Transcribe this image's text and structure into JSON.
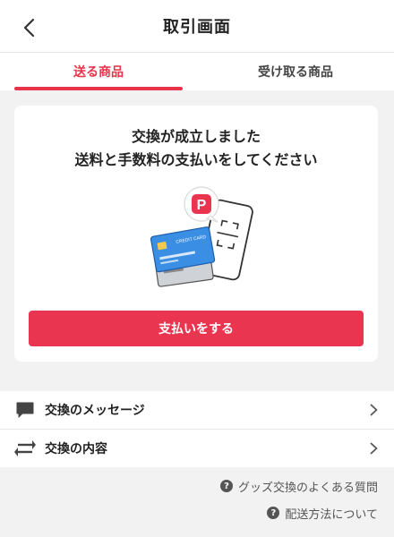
{
  "header": {
    "title": "取引画面",
    "back_icon": "chevron-left-icon"
  },
  "tabs": [
    {
      "label": "送る商品",
      "active": true
    },
    {
      "label": "受け取る商品",
      "active": false
    }
  ],
  "card": {
    "message_line1": "交換が成立しました",
    "message_line2": "送料と手数料の支払いをしてください",
    "illustration": {
      "paypay_badge": "P",
      "card_text": "CREDIT CARD"
    },
    "pay_button": "支払いをする"
  },
  "list": [
    {
      "label": "交換のメッセージ",
      "icon": "chat-bubble-icon"
    },
    {
      "label": "交換の内容",
      "icon": "swap-arrows-icon"
    }
  ],
  "help_links": [
    {
      "label": "グッズ交換のよくある質問",
      "icon": "question-circle-icon"
    },
    {
      "label": "配送方法について",
      "icon": "question-circle-icon"
    }
  ],
  "colors": {
    "accent": "#e8334a",
    "button": "#ea3550",
    "background": "#f2f2f2"
  }
}
